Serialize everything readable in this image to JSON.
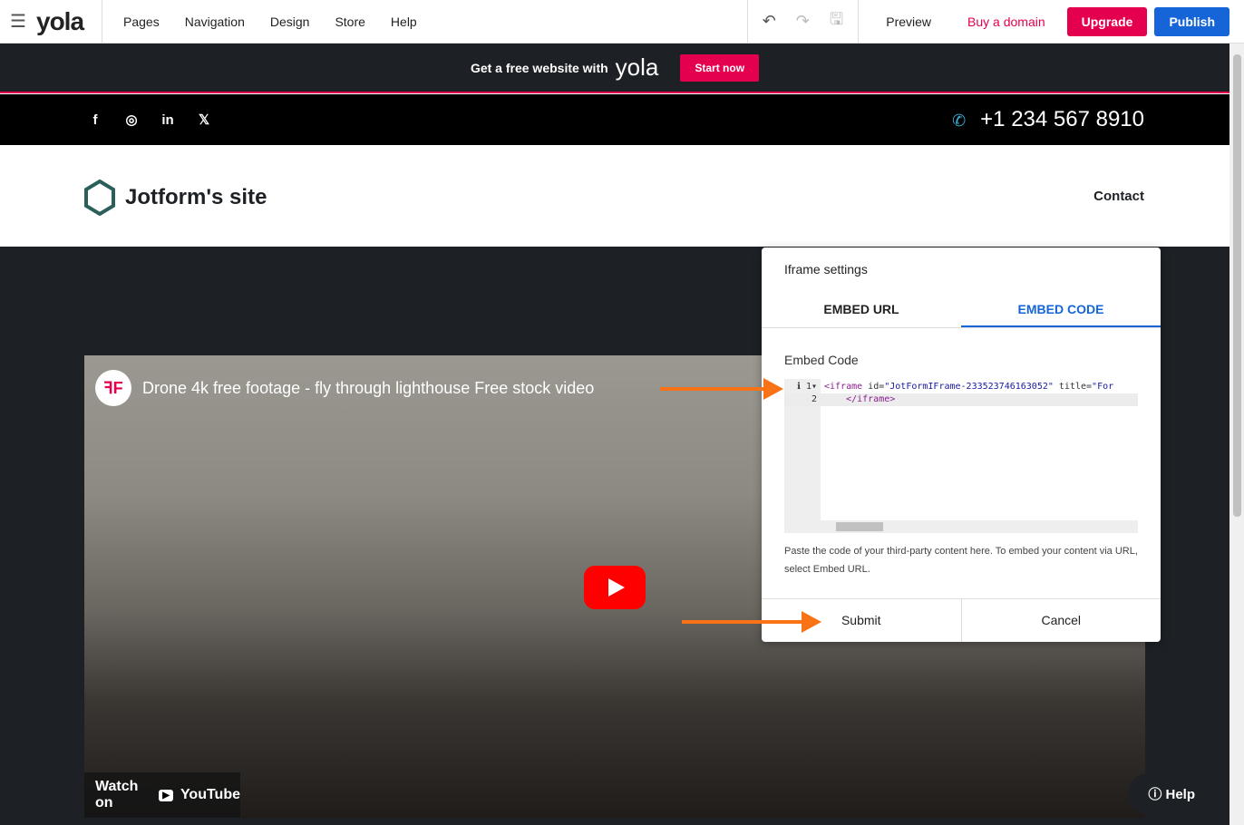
{
  "topbar": {
    "logo": "yola",
    "menu": [
      "Pages",
      "Navigation",
      "Design",
      "Store",
      "Help"
    ],
    "preview": "Preview",
    "buy_domain": "Buy a domain",
    "upgrade": "Upgrade",
    "publish": "Publish"
  },
  "promo": {
    "text": "Get a free website with",
    "brand": "yola",
    "start": "Start now"
  },
  "social": {
    "phone": "+1 234 567 8910"
  },
  "header": {
    "site_name": "Jotform's site",
    "contact": "Contact"
  },
  "video": {
    "title": "Drone 4k free footage - fly through lighthouse Free stock video",
    "watch_on": "Watch on",
    "youtube": "YouTube"
  },
  "dialog": {
    "title": "Iframe settings",
    "tabs": [
      "EMBED URL",
      "EMBED CODE"
    ],
    "active_tab": "EMBED CODE",
    "label": "Embed Code",
    "code": {
      "line1_tag": "<iframe",
      "line1_attr1": " id=",
      "line1_val1": "\"JotFormIFrame-233523746163052\"",
      "line1_attr2": " title=",
      "line1_val2": "\"For",
      "line2": "    </iframe>"
    },
    "hint": "Paste the code of your third-party content here. To embed your content via URL, select Embed URL.",
    "submit": "Submit",
    "cancel": "Cancel"
  },
  "help": "Help"
}
